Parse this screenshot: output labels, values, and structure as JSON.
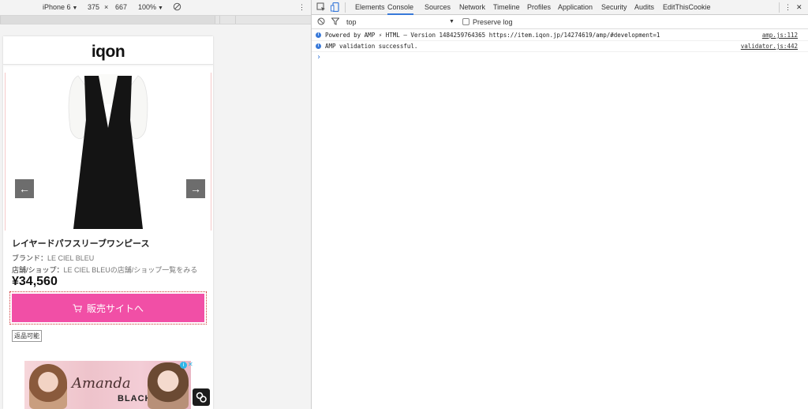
{
  "device_toolbar": {
    "device": "iPhone 6",
    "width": "375",
    "times": "×",
    "height": "667",
    "zoom": "100%",
    "caret": "▼",
    "more": "⋮"
  },
  "site": {
    "logo": "iqon",
    "product_name": "レイヤードパフスリーブワンピース",
    "brand_label": "ブランド：",
    "brand_value": "LE CIEL BLEU",
    "shop_label": "店舗/ショップ：",
    "shop_value": "LE CIEL BLEUの店舗/ショップ一覧をみる",
    "price": "¥34,560",
    "buy_button": "販売サイトへ",
    "return_badge": "返品可能",
    "ad_script_text": "Amanda",
    "ad_black_text": "BLACK",
    "ad_info": "i",
    "ad_close": "✕",
    "prev_arrow": "←",
    "next_arrow": "→"
  },
  "devtools": {
    "tabs": [
      "Elements",
      "Console",
      "Sources",
      "Network",
      "Timeline",
      "Profiles",
      "Application",
      "Security",
      "Audits",
      "EditThisCookie"
    ],
    "active_tab": "Console",
    "more": "⋮",
    "close": "✕",
    "context": "top",
    "context_caret": "▼",
    "preserve_log": "Preserve log",
    "accent": "#3879d9"
  },
  "console": {
    "lines": [
      {
        "message": "Powered by AMP ⚡ HTML – Version 1484259764365 https://item.iqon.jp/14274619/amp/#development=1",
        "source": "amp.js:112"
      },
      {
        "message": "AMP validation successful.",
        "source": "validator.js:442"
      }
    ],
    "prompt": "›"
  },
  "colors": {
    "buy_button": "#f14fa6",
    "arrow_buttons": "#6d6d6d"
  }
}
